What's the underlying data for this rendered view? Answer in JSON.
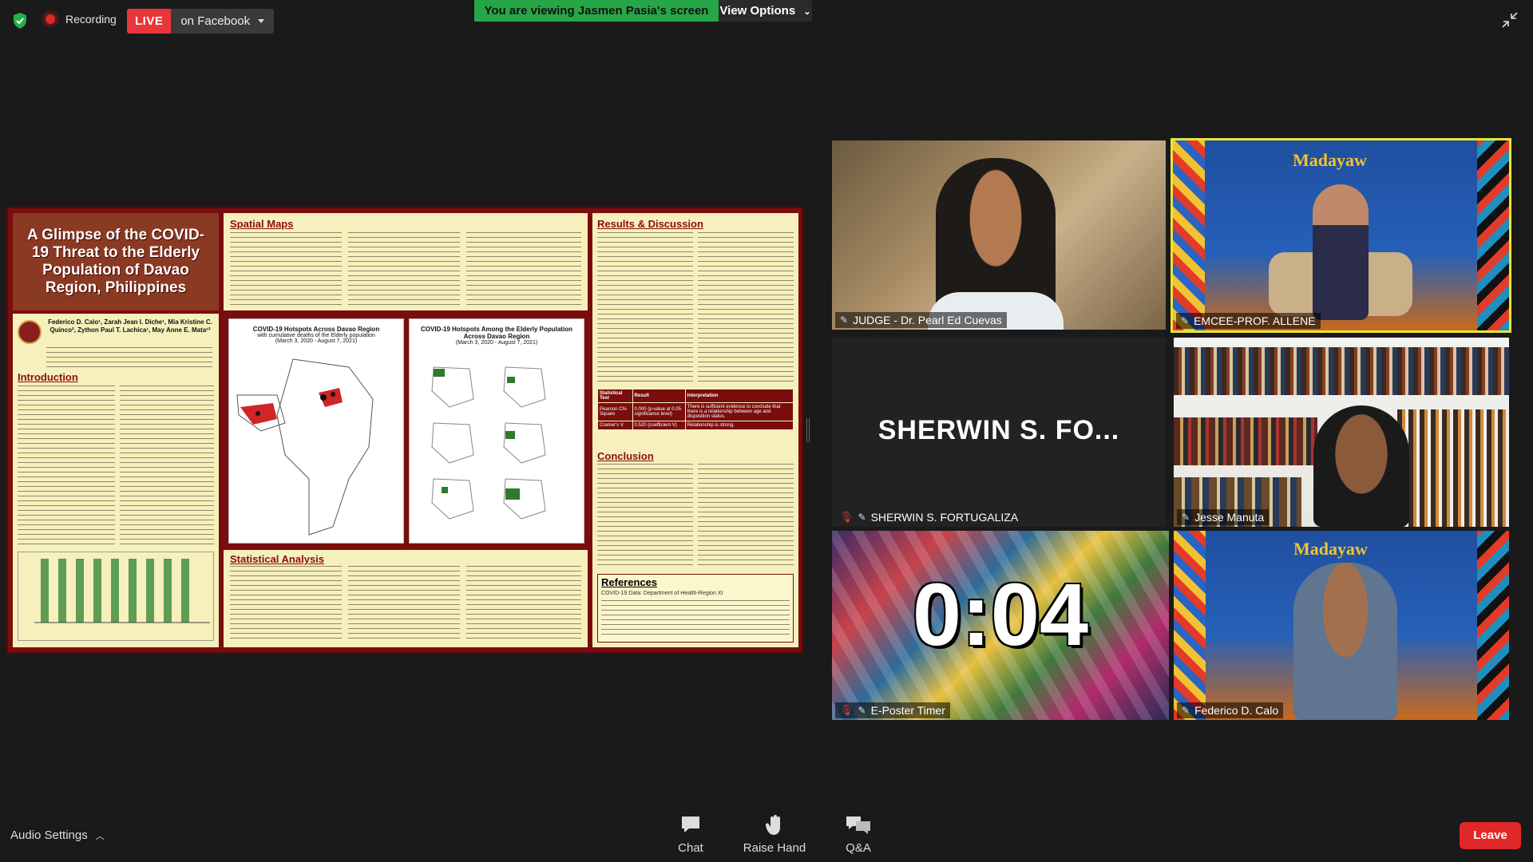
{
  "topbar": {
    "recording_label": "Recording",
    "live_label": "LIVE",
    "live_target": "on Facebook",
    "viewing_banner": "You are viewing Jasmen Pasia's screen",
    "view_options_label": "View Options"
  },
  "poster": {
    "title": "A Glimpse of the COVID-19 Threat to the Elderly Population of Davao Region, Philippines",
    "authors": "Federico D. Calo¹, Zarah Jean I. Diche¹, Mia Kristine C. Quinco², Zython Paul T. Lachica¹, May Anne E. Mata¹²",
    "sections": {
      "introduction": "Introduction",
      "spatial_maps": "Spatial Maps",
      "statistical_analysis": "Statistical Analysis",
      "results": "Results & Discussion",
      "conclusion": "Conclusion",
      "references": "References"
    },
    "fig1_title": "COVID-19 Hotspots Across Davao Region",
    "fig1_subtitle": "with cumulative deaths of the Elderly population",
    "fig1_dates": "(March 3, 2020 - August 7, 2021)",
    "fig2_title": "COVID-19 Hotspots Among the Elderly Population Across Davao Region",
    "fig2_dates": "(March 3, 2020 - August 7, 2021)",
    "table": {
      "headers": [
        "Statistical Test",
        "Result",
        "Interpretation"
      ],
      "rows": [
        [
          "Pearson Chi-Square",
          "0.000 (p-value at 0.05 significance level)",
          "There is sufficient evidence to conclude that there is a relationship between age and disposition status."
        ],
        [
          "Cramer's V",
          "0.520 (coefficient V)",
          "Relationship is strong."
        ]
      ]
    },
    "ref1": "COVID-19 Data: Department of Health-Region XI"
  },
  "participants": [
    {
      "name": "JUDGE - Dr. Pearl Ed Cuevas",
      "muted": false
    },
    {
      "name": "EMCEE-PROF. ALLENE",
      "muted": false,
      "active_speaker": true
    },
    {
      "name": "SHERWIN S. FORTUGALIZA",
      "muted": true,
      "display": "SHERWIN S. FO..."
    },
    {
      "name": "Jesse Manuta",
      "muted": false
    },
    {
      "name": "E-Poster Timer",
      "muted": true,
      "timer": "0:04"
    },
    {
      "name": "Federico D. Calo",
      "muted": false
    }
  ],
  "toolbar": {
    "audio_settings": "Audio Settings",
    "chat": "Chat",
    "raise_hand": "Raise Hand",
    "qa": "Q&A",
    "leave": "Leave"
  },
  "colors": {
    "live_red": "#e8363a",
    "banner_green": "#26a646",
    "leave_red": "#e02828",
    "active_speaker_border": "#e8e53a"
  }
}
